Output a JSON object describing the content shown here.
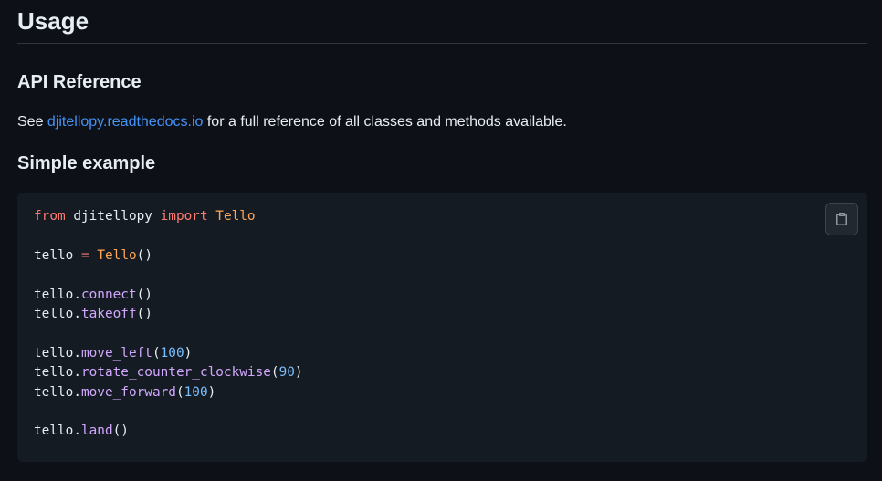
{
  "headings": {
    "usage": "Usage",
    "api_reference": "API Reference",
    "simple_example": "Simple example"
  },
  "api_paragraph": {
    "before": "See ",
    "link_text": "djitellopy.readthedocs.io",
    "after": " for a full reference of all classes and methods available."
  },
  "code_block": {
    "language": "python",
    "copy_icon": "clipboard-icon",
    "lines": [
      {
        "tokens": [
          {
            "t": "from",
            "k": "kw"
          },
          {
            "t": " djitellopy ",
            "k": "plain"
          },
          {
            "t": "import",
            "k": "kw"
          },
          {
            "t": " ",
            "k": "plain"
          },
          {
            "t": "Tello",
            "k": "cls"
          }
        ]
      },
      {
        "tokens": []
      },
      {
        "tokens": [
          {
            "t": "tello ",
            "k": "plain"
          },
          {
            "t": "=",
            "k": "kw"
          },
          {
            "t": " ",
            "k": "plain"
          },
          {
            "t": "Tello",
            "k": "cls"
          },
          {
            "t": "()",
            "k": "plain"
          }
        ]
      },
      {
        "tokens": []
      },
      {
        "tokens": [
          {
            "t": "tello.",
            "k": "plain"
          },
          {
            "t": "connect",
            "k": "fn"
          },
          {
            "t": "()",
            "k": "plain"
          }
        ]
      },
      {
        "tokens": [
          {
            "t": "tello.",
            "k": "plain"
          },
          {
            "t": "takeoff",
            "k": "fn"
          },
          {
            "t": "()",
            "k": "plain"
          }
        ]
      },
      {
        "tokens": []
      },
      {
        "tokens": [
          {
            "t": "tello.",
            "k": "plain"
          },
          {
            "t": "move_left",
            "k": "fn"
          },
          {
            "t": "(",
            "k": "plain"
          },
          {
            "t": "100",
            "k": "num"
          },
          {
            "t": ")",
            "k": "plain"
          }
        ]
      },
      {
        "tokens": [
          {
            "t": "tello.",
            "k": "plain"
          },
          {
            "t": "rotate_counter_clockwise",
            "k": "fn"
          },
          {
            "t": "(",
            "k": "plain"
          },
          {
            "t": "90",
            "k": "num"
          },
          {
            "t": ")",
            "k": "plain"
          }
        ]
      },
      {
        "tokens": [
          {
            "t": "tello.",
            "k": "plain"
          },
          {
            "t": "move_forward",
            "k": "fn"
          },
          {
            "t": "(",
            "k": "plain"
          },
          {
            "t": "100",
            "k": "num"
          },
          {
            "t": ")",
            "k": "plain"
          }
        ]
      },
      {
        "tokens": []
      },
      {
        "tokens": [
          {
            "t": "tello.",
            "k": "plain"
          },
          {
            "t": "land",
            "k": "fn"
          },
          {
            "t": "()",
            "k": "plain"
          }
        ]
      }
    ]
  },
  "colors": {
    "background": "#0d1117",
    "code_background": "#151b23",
    "text": "#e6edf3",
    "link": "#4493f8",
    "keyword": "#ff7b72",
    "class": "#ffa657",
    "function": "#d2a8ff",
    "number": "#79c0ff"
  }
}
